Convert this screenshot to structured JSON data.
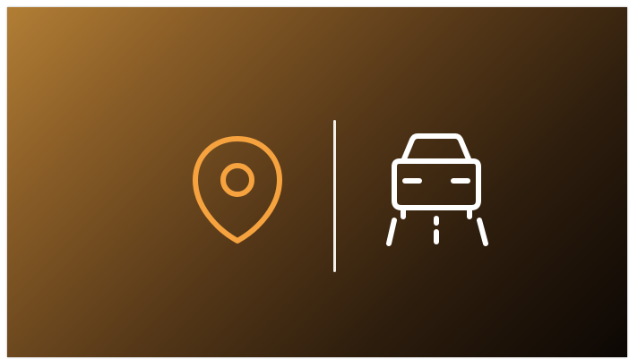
{
  "scene": {
    "background_gradient": [
      "#b27e35",
      "#563818",
      "#0c0704"
    ],
    "accent_color": "#f6a33f",
    "line_color": "#ffffff"
  },
  "icons": [
    {
      "name": "location-pin-icon",
      "color": "#f6a33f"
    },
    {
      "name": "vertical-divider",
      "color": "#f4efe8"
    },
    {
      "name": "car-on-road-icon",
      "color": "#ffffff"
    }
  ]
}
